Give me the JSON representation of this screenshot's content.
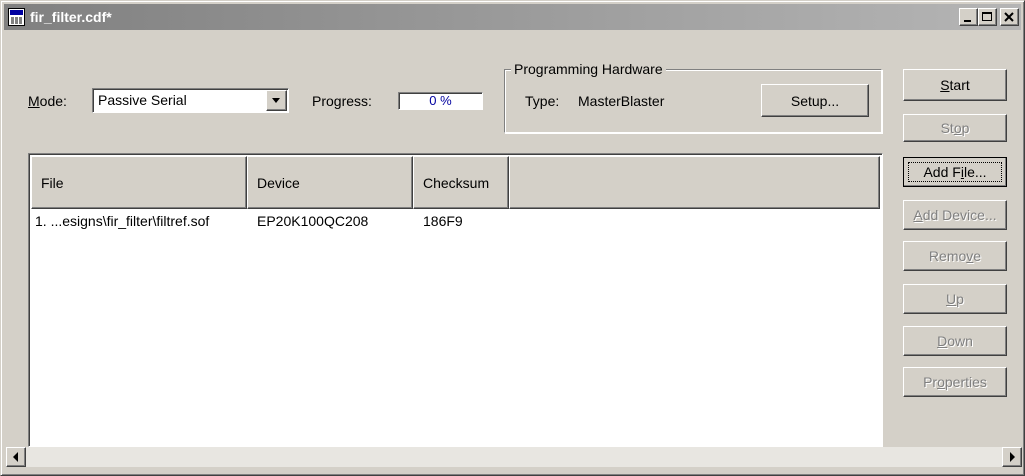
{
  "window": {
    "title": "fir_filter.cdf*"
  },
  "mode": {
    "label_prefix": "",
    "label_accel": "M",
    "label_rest": "ode:",
    "value": "Passive Serial"
  },
  "progress": {
    "label": "Progress:",
    "value": "0 %",
    "percent": 0
  },
  "hardware": {
    "group_title": "Programming Hardware",
    "type_label": "Type:",
    "type_value": "MasterBlaster",
    "setup_label": "Setup..."
  },
  "table": {
    "columns": [
      "File",
      "Device",
      "Checksum",
      ""
    ],
    "rows": [
      {
        "file": "1. ...esigns\\fir_filter\\filtref.sof",
        "device": "EP20K100QC208",
        "checksum": "186F9"
      }
    ]
  },
  "buttons": {
    "start": {
      "pre": "",
      "accel": "S",
      "post": "tart",
      "enabled": true
    },
    "stop": {
      "pre": "St",
      "accel": "o",
      "post": "p",
      "enabled": false
    },
    "add_file": {
      "pre": "Add F",
      "accel": "i",
      "post": "le...",
      "enabled": true
    },
    "add_device": {
      "pre": "",
      "accel": "A",
      "post": "dd Device...",
      "enabled": false
    },
    "remove": {
      "pre": "Remo",
      "accel": "v",
      "post": "e",
      "enabled": false
    },
    "up": {
      "pre": "",
      "accel": "U",
      "post": "p",
      "enabled": false
    },
    "down": {
      "pre": "",
      "accel": "D",
      "post": "own",
      "enabled": false
    },
    "properties": {
      "pre": "Pr",
      "accel": "o",
      "post": "perties",
      "enabled": false
    }
  },
  "icons": {
    "title": "programmer-app-icon",
    "minimize": "minimize-icon",
    "maximize": "maximize-icon",
    "close": "close-icon",
    "combo": "dropdown-arrow-icon",
    "scroll_left": "scroll-left-arrow-icon",
    "scroll_right": "scroll-right-arrow-icon"
  },
  "colors": {
    "titlebar_inactive": "#808080",
    "face": "#d4d0c8",
    "progress_text": "#0000a0"
  }
}
